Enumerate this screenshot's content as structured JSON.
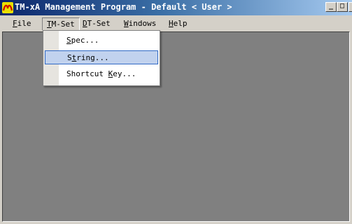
{
  "window": {
    "title": "TM-xA Management Program - Default < User >"
  },
  "menubar": {
    "items": [
      {
        "label": "File",
        "mnemonic": "F",
        "rest": "ile"
      },
      {
        "label": "TM-Set",
        "mnemonic": "T",
        "rest": "M-Set"
      },
      {
        "label": "DT-Set",
        "mnemonic": "D",
        "rest": "T-Set"
      },
      {
        "label": "Windows",
        "mnemonic": "W",
        "rest": "indows"
      },
      {
        "label": "Help",
        "mnemonic": "H",
        "rest": "elp"
      }
    ]
  },
  "dropdown": {
    "items": [
      {
        "label": "Spec...",
        "pre": "",
        "mnemonic": "S",
        "post": "pec..."
      },
      {
        "label": "String...",
        "pre": "S",
        "mnemonic": "t",
        "post": "ring...",
        "highlighted": true
      },
      {
        "label": "Shortcut Key...",
        "pre": "Shortcut ",
        "mnemonic": "K",
        "post": "ey..."
      }
    ]
  },
  "colors": {
    "titlebar_start": "#0a246a",
    "titlebar_end": "#a6caf0",
    "workspace": "#808080",
    "highlight": "#c1d2ee",
    "highlight_border": "#316ac5"
  },
  "icons": {
    "app": "app-logo-icon",
    "minimize": "minimize-icon",
    "maximize": "maximize-icon",
    "close": "close-icon"
  }
}
